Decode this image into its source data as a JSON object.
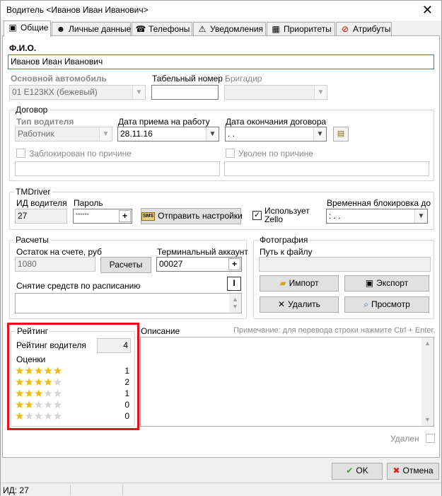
{
  "window": {
    "title": "Водитель <Иванов Иван Иванович>",
    "close_glyph": "✕"
  },
  "tabs": [
    {
      "label": "Общие",
      "icon": "card-icon",
      "glyph": "▣"
    },
    {
      "label": "Личные данные",
      "icon": "person-icon",
      "glyph": "☻"
    },
    {
      "label": "Телефоны",
      "icon": "phone-icon",
      "glyph": "☎"
    },
    {
      "label": "Уведомления",
      "icon": "warning-icon",
      "glyph": "⚠"
    },
    {
      "label": "Приоритеты",
      "icon": "chart-icon",
      "glyph": "▦"
    },
    {
      "label": "Атрибуты",
      "icon": "no-smoking-icon",
      "glyph": "⊘"
    }
  ],
  "fio": {
    "label": "Ф.И.О.",
    "value": "Иванов Иван Иванович"
  },
  "car": {
    "label": "Основной автомобиль",
    "value": "01 Е123КХ (бежевый)"
  },
  "tabel": {
    "label": "Табельный номер",
    "value": ""
  },
  "brigadir": {
    "label": "Бригадир",
    "value": ""
  },
  "contract": {
    "group_title": "Договор",
    "type_label": "Тип водителя",
    "type_value": "Работник",
    "hire_label": "Дата приема на работу",
    "hire_value": "28.11.16",
    "end_label": "Дата окончания договора",
    "end_value": " .  .",
    "blocked_label": "Заблокирован по причине",
    "fired_label": "Уволен по причине"
  },
  "tmdriver": {
    "group_title": "TMDriver",
    "id_label": "ИД водителя",
    "id_value": "27",
    "pass_label": "Пароль",
    "pass_value": "******",
    "plus": "+",
    "send_button": "Отправить настройки",
    "sms": "SMS",
    "zello_label": "Использует Zello",
    "zello_check": "✓",
    "block_label": "Временная блокировка до",
    "block_value": "  :    .   ."
  },
  "payments": {
    "group_title": "Расчеты",
    "balance_label": "Остаток на счете, руб",
    "balance_value": "1080",
    "calc_button": "Расчеты",
    "terminal_label": "Терминальный аккаунт",
    "terminal_value": "00027",
    "plus": "+",
    "schedule_label": "Снятие средств по расписанию",
    "schedule_icon": "I"
  },
  "photo": {
    "group_title": "Фотография",
    "path_label": "Путь к файлу",
    "import_button": "Импорт",
    "export_button": "Экспорт",
    "delete_button": "Удалить",
    "view_button": "Просмотр",
    "import_glyph": "▰",
    "export_glyph": "▣",
    "delete_glyph": "✕",
    "view_glyph": "⌕"
  },
  "rating": {
    "group_title": "Рейтинг",
    "driver_label": "Рейтинг водителя",
    "driver_value": "4",
    "scores_label": "Оценки",
    "scores": [
      {
        "stars": 5,
        "count": "1"
      },
      {
        "stars": 4,
        "count": "2"
      },
      {
        "stars": 3,
        "count": "1"
      },
      {
        "stars": 2,
        "count": "0"
      },
      {
        "stars": 1,
        "count": "0"
      }
    ]
  },
  "description": {
    "label": "Описание",
    "hint": "Примечание: для перевода строки нажмите Ctrl + Enter."
  },
  "deleted_label": "Удален",
  "buttons": {
    "ok": "OK",
    "cancel": "Отмена",
    "ok_glyph": "✔",
    "cancel_glyph": "✖"
  },
  "status": {
    "id_text": "ИД: 27"
  },
  "colors": {
    "highlight_box": "#e8101a",
    "star_on": "#f2b705",
    "star_off": "#d3d3d3"
  }
}
